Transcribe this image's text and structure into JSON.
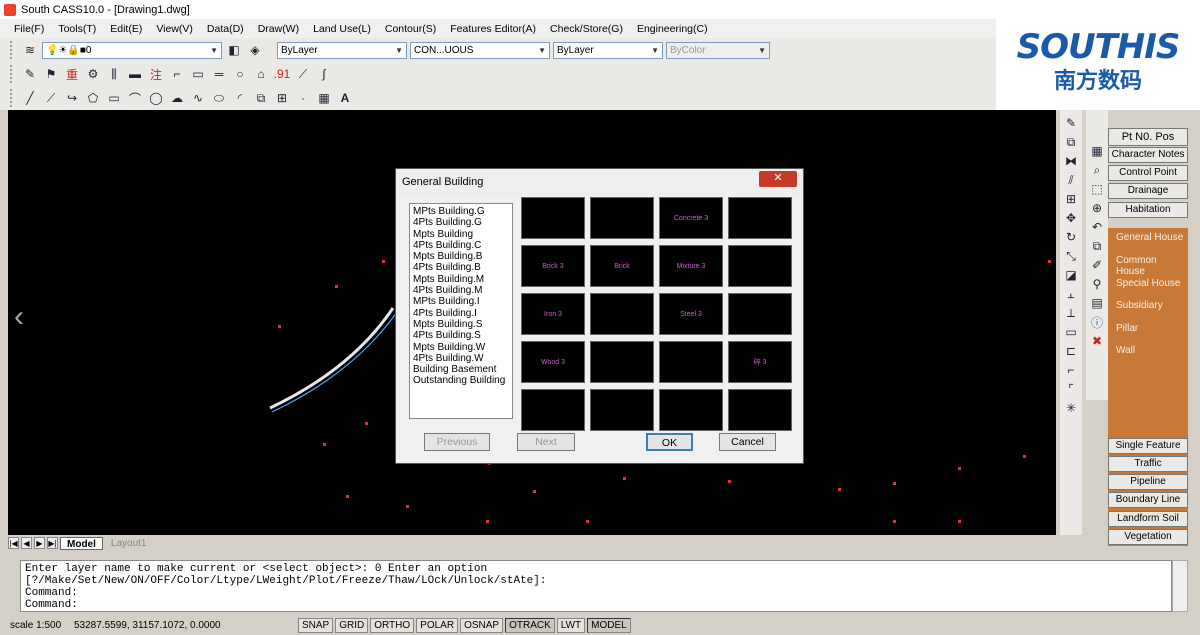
{
  "window": {
    "title": "South CASS10.0 - [Drawing1.dwg]"
  },
  "menu": [
    "File(F)",
    "Tools(T)",
    "Edit(E)",
    "View(V)",
    "Data(D)",
    "Draw(W)",
    "Land Use(L)",
    "Contour(S)",
    "Features Editor(A)",
    "Check/Store(G)",
    "Engineering(C)"
  ],
  "toolbar": {
    "layer_value": "0",
    "color_value": "ByLayer",
    "linetype_value": "CON...UOUS",
    "lineweight_value": "ByLayer",
    "plotstyle_value": "ByColor",
    "icons1": [
      "layer-manager-icon",
      "bulb-icon",
      "sun-icon",
      "lock-icon",
      "color-square-icon"
    ],
    "icons2": [
      "pen-icon",
      "marker-icon",
      "chinese-char-icon",
      "settings-icon",
      "fence-icon",
      "line-tool-icon",
      "zhu-char-icon",
      "rect-select-icon",
      "rect-icon",
      "dash-icon",
      "circles-icon",
      "building-icon",
      "number-icon",
      "line-icon",
      "double-line-icon"
    ],
    "icons3": [
      "line-draw-icon",
      "polyline-icon",
      "arc-arrow-icon",
      "polygon-icon",
      "rectangle-icon",
      "arc-icon",
      "circle-icon",
      "cloud-icon",
      "spline-icon",
      "ellipse-icon",
      "ellipse-arc-icon",
      "block-icon",
      "insert-icon",
      "point-icon",
      "hatch-icon",
      "text-icon"
    ]
  },
  "logo": {
    "main": "SOUTHIS",
    "sub": "南方数码"
  },
  "dialog": {
    "title": "General Building",
    "close": "✕",
    "list": [
      "MPts Building.G",
      "4Pts Building.G",
      "Mpts Building",
      "4Pts Building.C",
      "Mpts Building.B",
      "4Pts Building.B",
      "Mpts Building.M",
      "4Pts Building.M",
      "MPts Building.I",
      "4Pts Building.I",
      "Mpts Building.S",
      "4Pts Building.S",
      "Mpts Building.W",
      "4Pts Building.W",
      "Building Basement",
      "Outstanding Building"
    ],
    "cells": [
      "",
      "",
      "Concrete 3",
      "",
      "Brick 3",
      "Brick",
      "Mixture 3",
      "",
      "Iron 3",
      "",
      "Steel 3",
      "",
      "Wood 3",
      "",
      "",
      "碎 3",
      "",
      "",
      "",
      ""
    ],
    "previous": "Previous",
    "next": "Next",
    "ok": "OK",
    "cancel": "Cancel"
  },
  "panel": {
    "header": "Pt N0. Pos",
    "top_buttons": [
      "Character Notes",
      "Control Point",
      "Drainage",
      "Habitation"
    ],
    "orange_items": [
      "General House",
      "Common House",
      "Special House",
      "Subsidiary",
      "Pillar",
      "Wall"
    ],
    "bottom_buttons": [
      "Single Feature",
      "Traffic",
      "Pipeline",
      "Boundary Line",
      "Landform Soil",
      "Vegetation"
    ]
  },
  "tabs": {
    "model": "Model",
    "layout": "Layout1"
  },
  "command": {
    "line1": "Enter layer name to make current or <select object>: 0 Enter an option",
    "line2": "[?/Make/Set/New/ON/OFF/Color/Ltype/LWeight/Plot/Freeze/Thaw/LOck/Unlock/stAte]:",
    "line3": "Command:",
    "line4": "Command:"
  },
  "status": {
    "scale": "scale  1:500",
    "coords": "53287.5599, 31157.1072, 0.0000",
    "buttons": [
      "SNAP",
      "GRID",
      "ORTHO",
      "POLAR",
      "OSNAP",
      "OTRACK",
      "LWT",
      "MODEL"
    ],
    "active": [
      "OTRACK",
      "MODEL"
    ]
  },
  "colors": {
    "canvas": "#000000",
    "accent": "#c87938",
    "brand": "#1b5aa8"
  }
}
